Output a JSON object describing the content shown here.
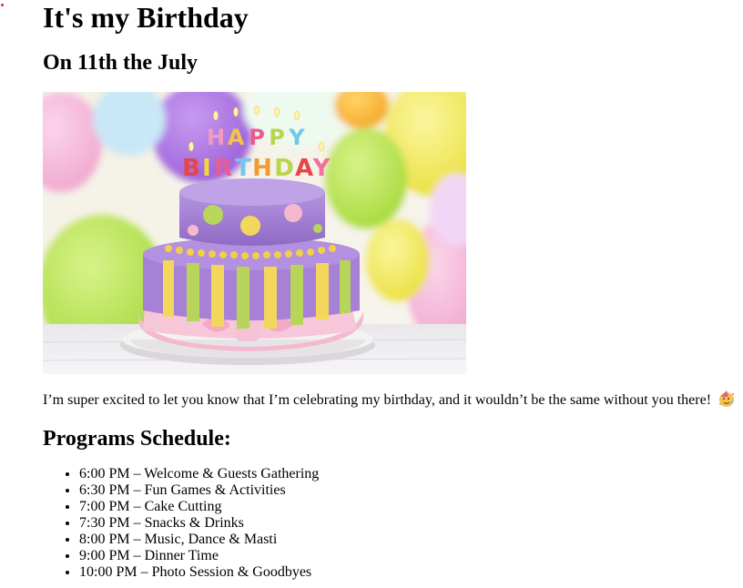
{
  "heading": "It's my Birthday",
  "date_heading": "On 11th the July",
  "hero_image": {
    "name": "birthday-cake-photo",
    "cake_text_top": "HAPPY",
    "cake_text_bottom": "BIRTHDAY"
  },
  "invite_text": "I’m super excited to let you know that I’m celebrating my birthday, and it wouldn’t be the same without you there!",
  "invite_emoji": "party-face-emoji",
  "schedule_title": "Programs Schedule:",
  "schedule": [
    "6:00 PM – Welcome & Guests Gathering",
    "6:30 PM – Fun Games & Activities",
    "7:00 PM – Cake Cutting",
    "7:30 PM – Snacks & Drinks",
    "8:00 PM – Music, Dance & Masti",
    "9:00 PM – Dinner Time",
    "10:00 PM – Photo Session & Goodbyes"
  ]
}
